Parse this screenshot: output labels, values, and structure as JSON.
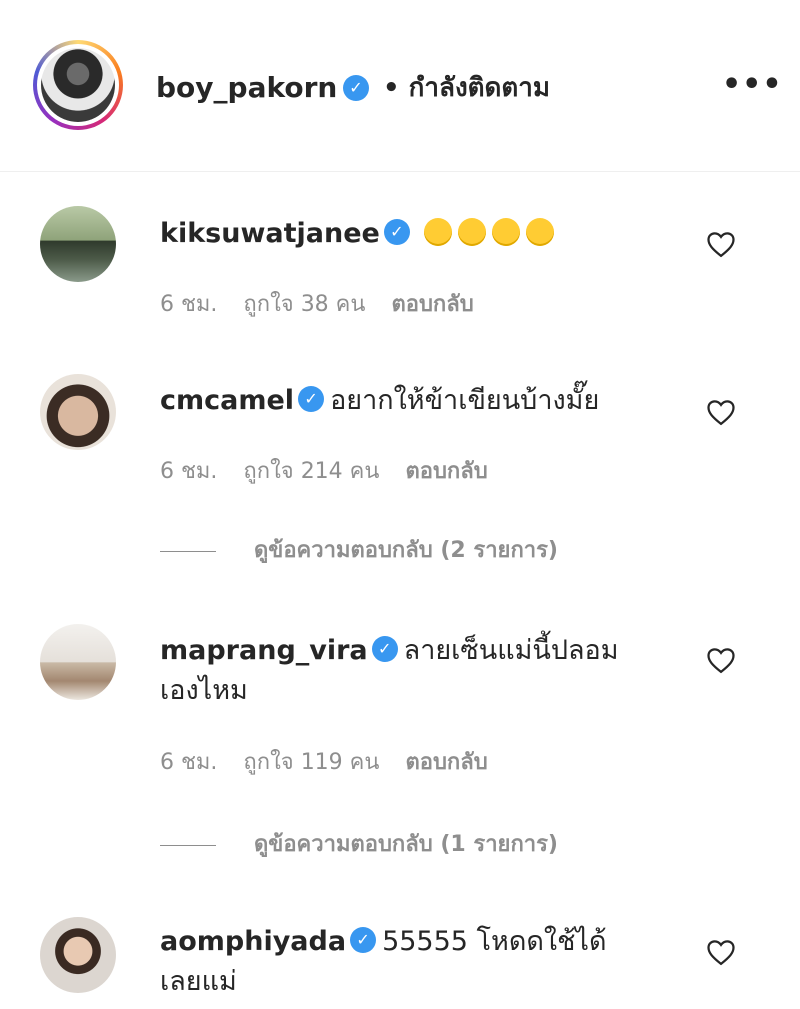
{
  "header": {
    "username": "boy_pakorn",
    "follow_status": "• กำลังติดตาม",
    "more_label": "•••"
  },
  "comments": [
    {
      "username": "kiksuwatjanee",
      "text": "😂😂😂😂",
      "time": "6 ชม.",
      "likes": "ถูกใจ 38 คน",
      "reply": "ตอบกลับ"
    },
    {
      "username": "cmcamel",
      "text": "อยากให้ข้าเขียนบ้างมั๊ย",
      "time": "6 ชม.",
      "likes": "ถูกใจ 214 คน",
      "reply": "ตอบกลับ",
      "view_replies": "ดูข้อความตอบกลับ (2 รายการ)"
    },
    {
      "username": "maprang_vira",
      "text_line1": "ลายเซ็นแม่นี้ปลอม",
      "text_line2": "เองไหม",
      "time": "6 ชม.",
      "likes": "ถูกใจ 119 คน",
      "reply": "ตอบกลับ",
      "view_replies": "ดูข้อความตอบกลับ (1 รายการ)"
    },
    {
      "username": "aomphiyada",
      "text_line1": "55555 โหดดใช้ได้",
      "text_line2": "เลยแม่"
    }
  ],
  "colors": {
    "verified": "#3897f0",
    "meta_text": "#8e8e8e",
    "text": "#262626"
  }
}
